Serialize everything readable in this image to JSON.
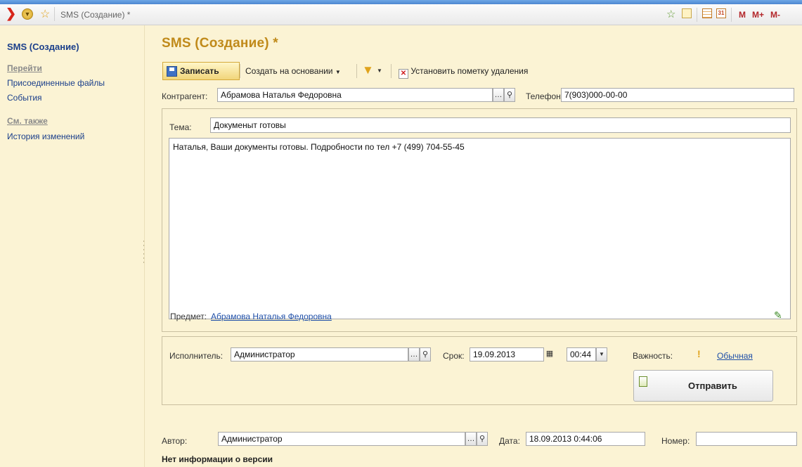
{
  "window": {
    "tab_title": "SMS (Создание) *",
    "toolbar_right": [
      "M",
      "M+",
      "M-"
    ]
  },
  "sidebar": {
    "title": "SMS (Создание)",
    "groups": [
      {
        "heading": "Перейти",
        "items": [
          "Присоединенные файлы",
          "События"
        ]
      },
      {
        "heading": "См. также",
        "items": [
          "История изменений"
        ]
      }
    ]
  },
  "form": {
    "title": "SMS (Создание) *",
    "toolbar": {
      "save_label": "Записать",
      "create_based_label": "Создать на основании",
      "mark_delete_label": "Установить пометку удаления"
    },
    "counterparty": {
      "label": "Контрагент:",
      "value": "Абрамова Наталья Федоровна"
    },
    "phone": {
      "label": "Телефон:",
      "value": "7(903)000-00-00"
    },
    "subject": {
      "label": "Тема:",
      "value": "Докуменыт готовы"
    },
    "message_text": "Наталья, Ваши документы готовы. Подробности по тел +7 (499) 704-55-45",
    "subject_link": {
      "label": "Предмет:",
      "value": "Абрамова Наталья Федоровна"
    },
    "executor": {
      "label": "Исполнитель:",
      "value": "Администратор"
    },
    "deadline": {
      "label": "Срок:",
      "date": "19.09.2013",
      "time": "00:44"
    },
    "importance": {
      "label": "Важность:",
      "value": "Обычная"
    },
    "send_label": "Отправить",
    "author": {
      "label": "Автор:",
      "value": "Администратор"
    },
    "date": {
      "label": "Дата:",
      "value": "18.09.2013  0:44:06"
    },
    "number": {
      "label": "Номер:",
      "value": ""
    },
    "version_info": "Нет информации о версии"
  }
}
